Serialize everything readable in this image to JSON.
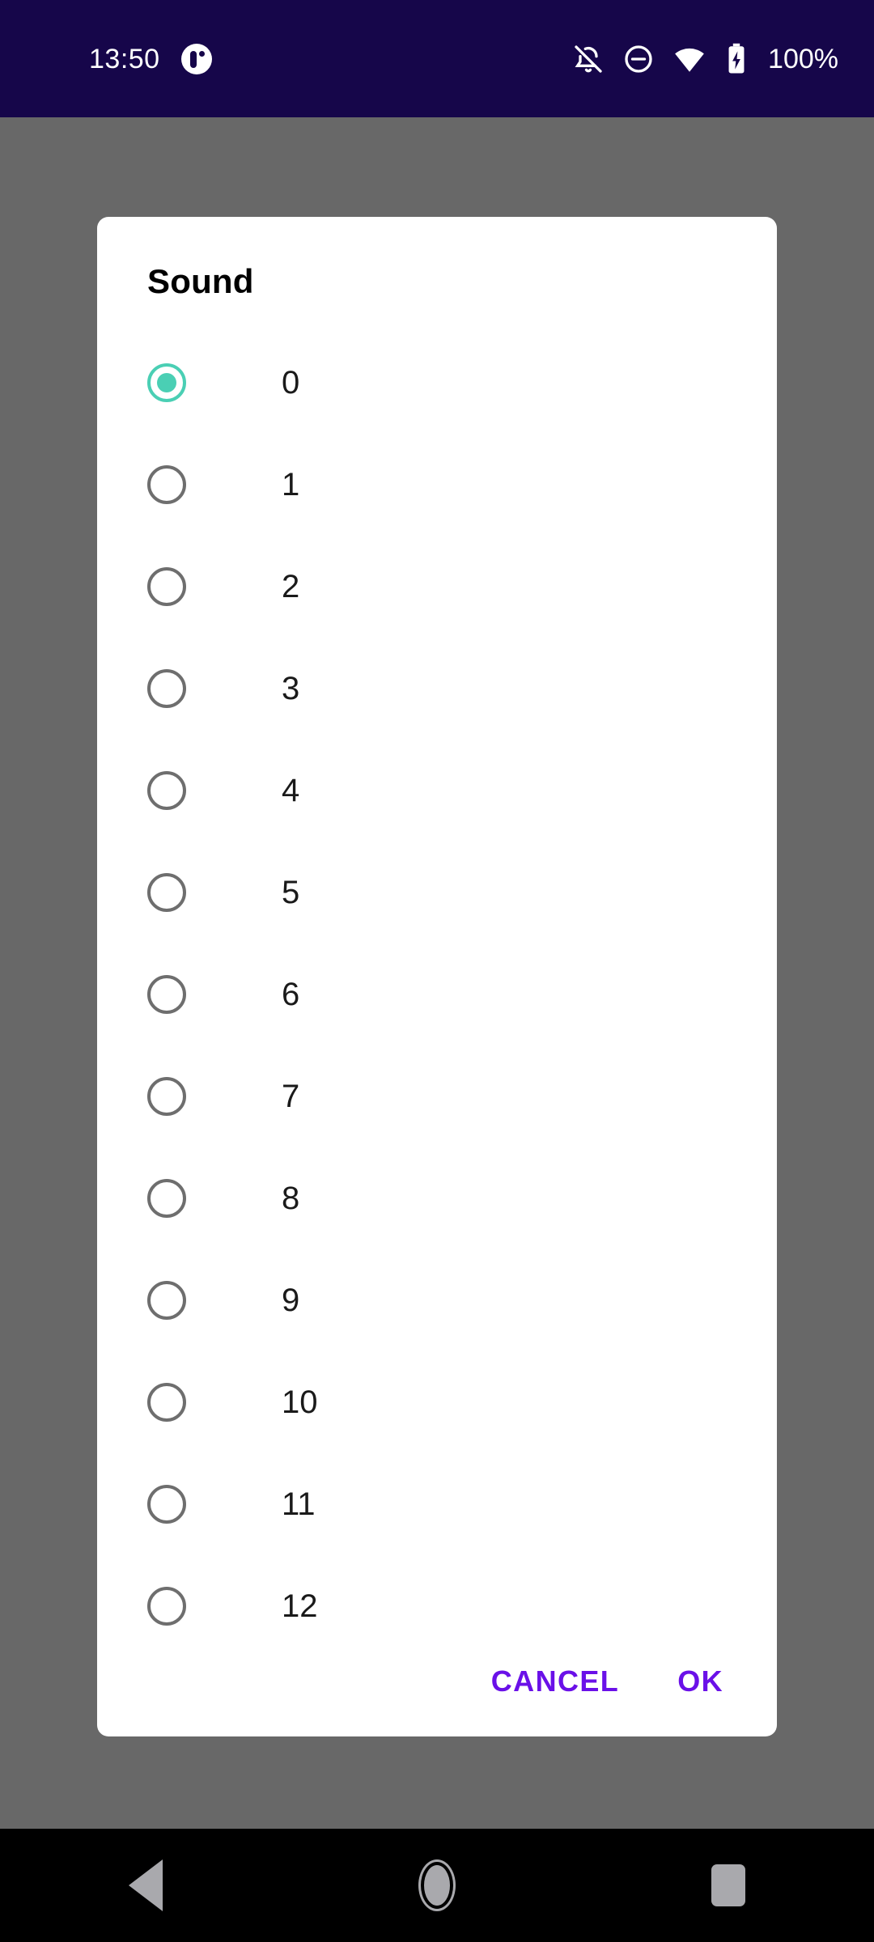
{
  "status_bar": {
    "clock": "13:50",
    "battery_text": "100%",
    "icons": {
      "notification_app": "app-notification-icon",
      "bell_off": "bell-off-icon",
      "do_not_disturb": "do-not-disturb-icon",
      "wifi": "wifi-icon",
      "battery_charging": "battery-charging-icon"
    },
    "background_color": "#16064A",
    "foreground_color": "#FFFFFF"
  },
  "dialog": {
    "title": "Sound",
    "selected_value": "0",
    "options": [
      {
        "label": "0",
        "selected": true
      },
      {
        "label": "1",
        "selected": false
      },
      {
        "label": "2",
        "selected": false
      },
      {
        "label": "3",
        "selected": false
      },
      {
        "label": "4",
        "selected": false
      },
      {
        "label": "5",
        "selected": false
      },
      {
        "label": "6",
        "selected": false
      },
      {
        "label": "7",
        "selected": false
      },
      {
        "label": "8",
        "selected": false
      },
      {
        "label": "9",
        "selected": false
      },
      {
        "label": "10",
        "selected": false
      },
      {
        "label": "11",
        "selected": false
      },
      {
        "label": "12",
        "selected": false
      }
    ],
    "actions": {
      "cancel_label": "CANCEL",
      "ok_label": "OK"
    },
    "colors": {
      "accent_selected": "#4ACFB4",
      "radio_unselected": "#6E6E6E",
      "action_text": "#6A10E8",
      "surface": "#FFFFFF",
      "scrim": "#686868"
    }
  },
  "navigation_bar": {
    "back": "back-button",
    "home": "home-button",
    "recents": "recents-button",
    "background_color": "#000000",
    "icon_color": "#A9A9AD"
  }
}
